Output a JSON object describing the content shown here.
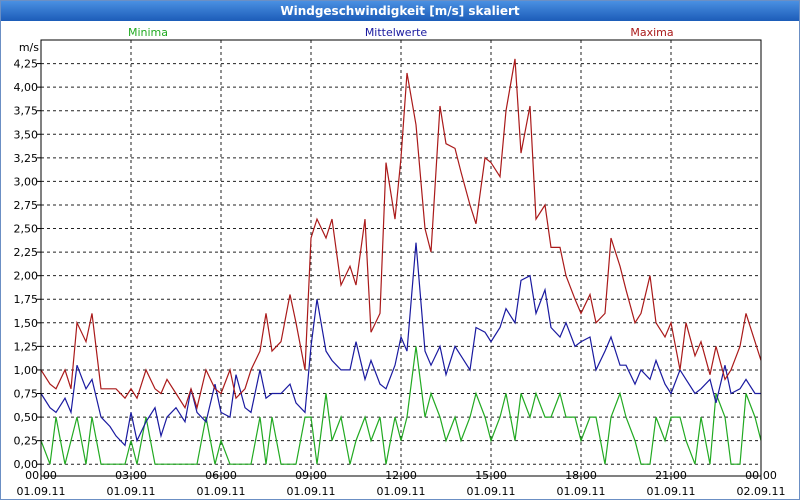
{
  "window": {
    "title": "Windgeschwindigkeit [m/s] skaliert"
  },
  "chart_data": {
    "type": "line",
    "title": "Windgeschwindigkeit [m/s] skaliert",
    "ylabel": "m/s",
    "ylim": [
      -0.125,
      4.5
    ],
    "xlim": [
      0,
      24
    ],
    "grid": true,
    "yticks": [
      "0,00",
      "0,25",
      "0,50",
      "0,75",
      "1,00",
      "1,25",
      "1,50",
      "1,75",
      "2,00",
      "2,25",
      "2,50",
      "2,75",
      "3,00",
      "3,25",
      "3,50",
      "3,75",
      "4,00",
      "4,25"
    ],
    "xticks": [
      {
        "time": "00:00",
        "date": "01.09.11"
      },
      {
        "time": "03:00",
        "date": "01.09.11"
      },
      {
        "time": "06:00",
        "date": "01.09.11"
      },
      {
        "time": "09:00",
        "date": "01.09.11"
      },
      {
        "time": "12:00",
        "date": "01.09.11"
      },
      {
        "time": "15:00",
        "date": "01.09.11"
      },
      {
        "time": "18:00",
        "date": "01.09.11"
      },
      {
        "time": "21:00",
        "date": "01.09.11"
      },
      {
        "time": "00:00",
        "date": "02.09.11"
      }
    ],
    "colors": {
      "Minima": "#22aa22",
      "Mittelwerte": "#1a1aa0",
      "Maxima": "#aa1a1a",
      "grid": "#222222"
    },
    "series": [
      {
        "name": "Minima",
        "x": [
          0,
          0.3,
          0.5,
          0.8,
          1.0,
          1.2,
          1.5,
          1.7,
          2.0,
          2.3,
          2.5,
          2.8,
          3.0,
          3.2,
          3.5,
          3.8,
          4.0,
          4.2,
          4.5,
          4.8,
          5.0,
          5.2,
          5.5,
          5.8,
          6.0,
          6.3,
          6.5,
          6.8,
          7.0,
          7.3,
          7.5,
          7.7,
          8.0,
          8.3,
          8.5,
          8.8,
          9.0,
          9.2,
          9.5,
          9.7,
          10.0,
          10.3,
          10.5,
          10.8,
          11.0,
          11.3,
          11.5,
          11.8,
          12.0,
          12.2,
          12.5,
          12.8,
          13.0,
          13.3,
          13.5,
          13.8,
          14.0,
          14.3,
          14.5,
          14.8,
          15.0,
          15.3,
          15.5,
          15.8,
          16.0,
          16.3,
          16.5,
          16.8,
          17.0,
          17.3,
          17.5,
          17.8,
          18.0,
          18.3,
          18.5,
          18.8,
          19.0,
          19.3,
          19.5,
          19.8,
          20.0,
          20.3,
          20.5,
          20.8,
          21.0,
          21.3,
          21.5,
          21.8,
          22.0,
          22.3,
          22.5,
          22.8,
          23.0,
          23.3,
          23.5,
          23.8,
          24.0
        ],
        "values": [
          0.25,
          0.0,
          0.5,
          0.0,
          0.25,
          0.5,
          0.0,
          0.5,
          0.0,
          0.0,
          0.0,
          0.0,
          0.25,
          0.0,
          0.5,
          0.0,
          0.0,
          0.0,
          0.0,
          0.0,
          0.0,
          0.0,
          0.5,
          0.0,
          0.25,
          0.0,
          0.0,
          0.0,
          0.0,
          0.5,
          0.0,
          0.5,
          0.0,
          0.0,
          0.0,
          0.5,
          0.5,
          0.0,
          0.75,
          0.25,
          0.5,
          0.0,
          0.25,
          0.5,
          0.25,
          0.5,
          0.0,
          0.5,
          0.25,
          0.5,
          1.25,
          0.5,
          0.75,
          0.5,
          0.25,
          0.5,
          0.25,
          0.5,
          0.75,
          0.5,
          0.25,
          0.5,
          0.75,
          0.25,
          0.75,
          0.5,
          0.75,
          0.5,
          0.5,
          0.75,
          0.5,
          0.5,
          0.25,
          0.5,
          0.5,
          0.0,
          0.5,
          0.75,
          0.5,
          0.25,
          0.0,
          0.0,
          0.5,
          0.25,
          0.5,
          0.5,
          0.25,
          0.0,
          0.5,
          0.0,
          0.75,
          0.5,
          0.0,
          0.0,
          0.75,
          0.5,
          0.25
        ]
      },
      {
        "name": "Mittelwerte",
        "x": [
          0,
          0.3,
          0.5,
          0.8,
          1.0,
          1.2,
          1.5,
          1.7,
          2.0,
          2.3,
          2.5,
          2.8,
          3.0,
          3.2,
          3.5,
          3.8,
          4.0,
          4.2,
          4.5,
          4.8,
          5.0,
          5.2,
          5.5,
          5.8,
          6.0,
          6.3,
          6.5,
          6.8,
          7.0,
          7.3,
          7.5,
          7.7,
          8.0,
          8.3,
          8.5,
          8.8,
          9.0,
          9.2,
          9.5,
          9.7,
          10.0,
          10.3,
          10.5,
          10.8,
          11.0,
          11.3,
          11.5,
          11.8,
          12.0,
          12.2,
          12.5,
          12.8,
          13.0,
          13.3,
          13.5,
          13.8,
          14.0,
          14.3,
          14.5,
          14.8,
          15.0,
          15.3,
          15.5,
          15.8,
          16.0,
          16.3,
          16.5,
          16.8,
          17.0,
          17.3,
          17.5,
          17.8,
          18.0,
          18.3,
          18.5,
          18.8,
          19.0,
          19.3,
          19.5,
          19.8,
          20.0,
          20.3,
          20.5,
          20.8,
          21.0,
          21.3,
          21.5,
          21.8,
          22.0,
          22.3,
          22.5,
          22.8,
          23.0,
          23.3,
          23.5,
          23.8,
          24.0
        ],
        "values": [
          0.75,
          0.6,
          0.55,
          0.7,
          0.55,
          1.05,
          0.8,
          0.9,
          0.5,
          0.4,
          0.3,
          0.2,
          0.55,
          0.25,
          0.45,
          0.6,
          0.3,
          0.5,
          0.6,
          0.45,
          0.8,
          0.55,
          0.45,
          0.85,
          0.55,
          0.5,
          0.95,
          0.6,
          0.55,
          1.0,
          0.7,
          0.75,
          0.75,
          0.85,
          0.65,
          0.55,
          1.25,
          1.75,
          1.2,
          1.1,
          1.0,
          1.0,
          1.3,
          0.9,
          1.1,
          0.85,
          0.8,
          1.05,
          1.35,
          1.2,
          2.35,
          1.2,
          1.05,
          1.25,
          0.95,
          1.25,
          1.15,
          1.0,
          1.45,
          1.4,
          1.3,
          1.45,
          1.65,
          1.5,
          1.95,
          2.0,
          1.6,
          1.85,
          1.45,
          1.35,
          1.5,
          1.25,
          1.3,
          1.35,
          1.0,
          1.2,
          1.35,
          1.05,
          1.05,
          0.85,
          1.0,
          0.9,
          1.1,
          0.85,
          0.75,
          1.0,
          0.9,
          0.75,
          0.8,
          0.9,
          0.65,
          1.05,
          0.75,
          0.8,
          0.9,
          0.75,
          0.75
        ]
      },
      {
        "name": "Maxima",
        "x": [
          0,
          0.3,
          0.5,
          0.8,
          1.0,
          1.2,
          1.5,
          1.7,
          2.0,
          2.3,
          2.5,
          2.8,
          3.0,
          3.2,
          3.5,
          3.8,
          4.0,
          4.2,
          4.5,
          4.8,
          5.0,
          5.2,
          5.5,
          5.8,
          6.0,
          6.3,
          6.5,
          6.8,
          7.0,
          7.3,
          7.5,
          7.7,
          8.0,
          8.3,
          8.5,
          8.8,
          9.0,
          9.2,
          9.5,
          9.7,
          10.0,
          10.3,
          10.5,
          10.8,
          11.0,
          11.3,
          11.5,
          11.8,
          12.0,
          12.2,
          12.5,
          12.8,
          13.0,
          13.3,
          13.5,
          13.8,
          14.0,
          14.3,
          14.5,
          14.8,
          15.0,
          15.3,
          15.5,
          15.8,
          16.0,
          16.3,
          16.5,
          16.8,
          17.0,
          17.3,
          17.5,
          17.8,
          18.0,
          18.3,
          18.5,
          18.8,
          19.0,
          19.3,
          19.5,
          19.8,
          20.0,
          20.3,
          20.5,
          20.8,
          21.0,
          21.3,
          21.5,
          21.8,
          22.0,
          22.3,
          22.5,
          22.8,
          23.0,
          23.3,
          23.5,
          23.8,
          24.0
        ],
        "values": [
          1.0,
          0.85,
          0.8,
          1.0,
          0.8,
          1.5,
          1.3,
          1.6,
          0.8,
          0.8,
          0.8,
          0.7,
          0.8,
          0.7,
          1.0,
          0.8,
          0.75,
          0.9,
          0.75,
          0.6,
          0.8,
          0.6,
          1.0,
          0.8,
          0.75,
          1.0,
          0.7,
          0.8,
          1.0,
          1.2,
          1.6,
          1.2,
          1.3,
          1.8,
          1.5,
          1.0,
          2.4,
          2.6,
          2.4,
          2.6,
          1.9,
          2.1,
          1.9,
          2.6,
          1.4,
          1.6,
          3.2,
          2.6,
          3.25,
          4.15,
          3.6,
          2.5,
          2.25,
          3.8,
          3.4,
          3.35,
          3.1,
          2.75,
          2.55,
          3.25,
          3.2,
          3.05,
          3.75,
          4.3,
          3.3,
          3.8,
          2.6,
          2.75,
          2.3,
          2.3,
          2.0,
          1.75,
          1.6,
          1.8,
          1.5,
          1.6,
          2.4,
          2.1,
          1.85,
          1.5,
          1.6,
          2.0,
          1.5,
          1.35,
          1.5,
          1.0,
          1.5,
          1.15,
          1.3,
          0.95,
          1.25,
          0.9,
          1.0,
          1.25,
          1.6,
          1.3,
          1.1
        ]
      }
    ]
  }
}
